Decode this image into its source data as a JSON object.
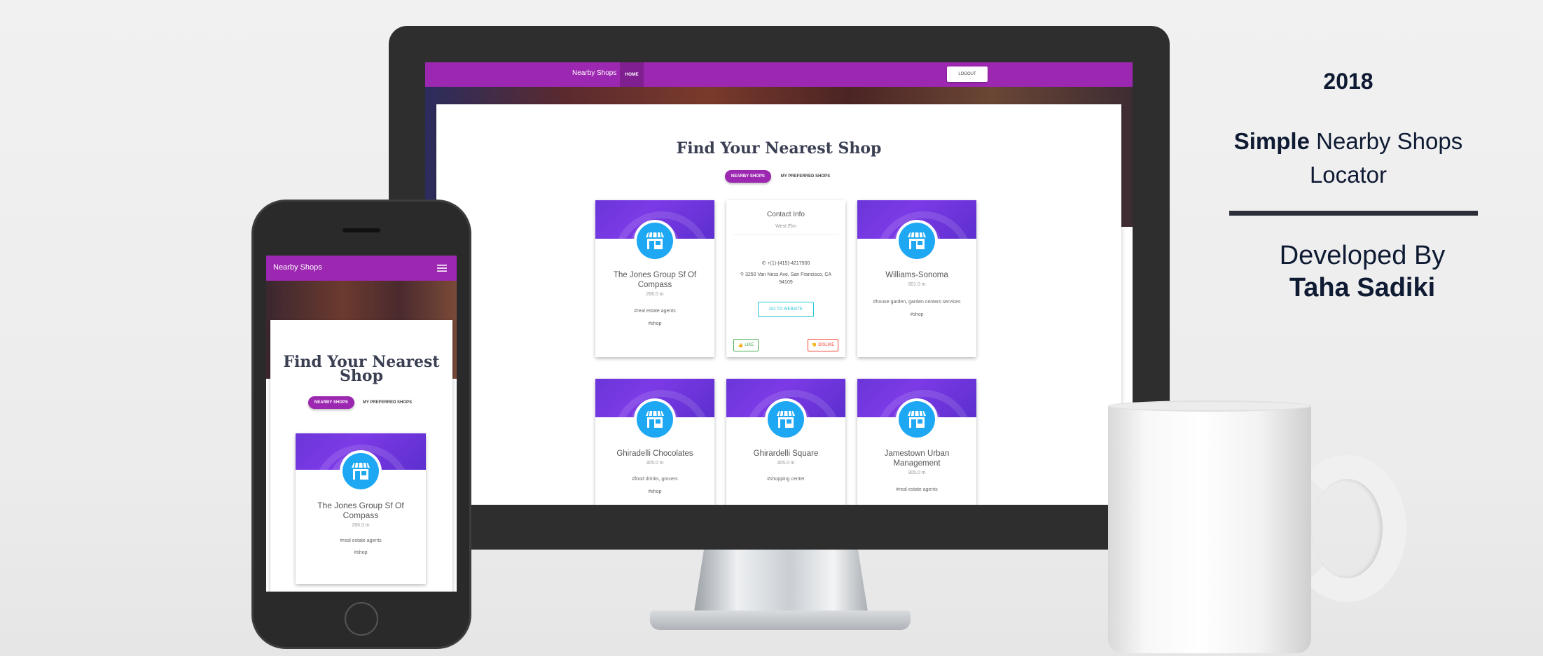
{
  "info": {
    "year": "2018",
    "tagline_bold": "Simple",
    "tagline_rest": "Nearby Shops Locator",
    "developed_by": "Developed By",
    "developer": "Taha Sadiki"
  },
  "desktop": {
    "nav": {
      "brand": "Nearby Shops",
      "home": "HOME",
      "logout": "LOGOUT"
    },
    "heading": "Find Your Nearest Shop",
    "tabs": {
      "active": "NEARBY SHOPS",
      "other": "MY PREFERRED SHOPS"
    },
    "cards": [
      {
        "name": "The Jones Group Sf Of Compass",
        "distance": "266.0 m",
        "tags": [
          "#real estate agents",
          "#shop"
        ]
      },
      {
        "contact_title": "Contact Info",
        "contact_name": "West Elm",
        "phone": "+(1)-(415)-4217900",
        "address": "3250 Van Ness Ave, San Francisco, CA 94109",
        "website": "GO TO WEBSITE",
        "like": "LIKE",
        "dislike": "DISLIKE"
      },
      {
        "name": "Williams-Sonoma",
        "distance": "301.0 m",
        "tags": [
          "#house garden, garden centers services",
          "#shop"
        ]
      },
      {
        "name": "Ghiradelli Chocolates",
        "distance": "305.0 m",
        "tags": [
          "#food drinks, grocers",
          "#shop"
        ]
      },
      {
        "name": "Ghirardelli Square",
        "distance": "305.0 m",
        "tags": [
          "#shopping center"
        ]
      },
      {
        "name": "Jamestown Urban Management",
        "distance": "305.0 m",
        "tags": [
          "#real estate agents"
        ]
      }
    ]
  },
  "mobile": {
    "nav": {
      "brand": "Nearby Shops"
    },
    "heading": "Find Your Nearest Shop",
    "tabs": {
      "active": "NEARBY SHOPS",
      "other": "MY PREFERRED SHOPS"
    },
    "card": {
      "name": "The Jones Group Sf Of Compass",
      "distance": "266.0 m",
      "tags": [
        "#real estate agents",
        "#shop"
      ]
    }
  },
  "icons": {
    "store": "store-icon",
    "menu": "hamburger-menu-icon",
    "phone": "phone-icon",
    "location": "map-marker-icon",
    "like": "thumbs-up-icon",
    "dislike": "thumbs-down-icon"
  },
  "colors": {
    "primary": "#9c27b0",
    "card_header": "#6a36d9",
    "store_circle": "#1ea7f2",
    "like": "#4caf50",
    "dislike": "#f44336",
    "website": "#26c6da",
    "text_dark": "#0f1a33"
  }
}
